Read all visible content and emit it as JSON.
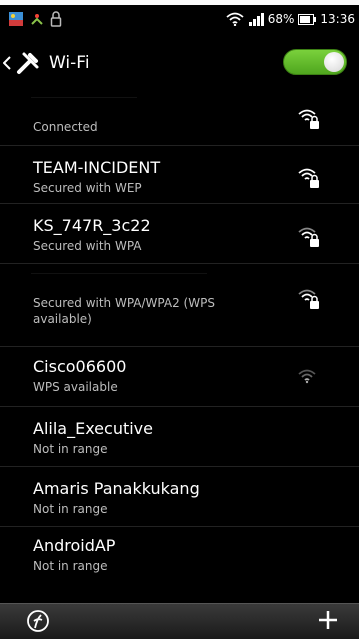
{
  "status_bar": {
    "battery_percent": "68%",
    "time": "13:36",
    "icons": [
      "notification-image-icon",
      "network-icon",
      "lock-icon",
      "wifi-status-icon",
      "signal-icon",
      "battery-icon"
    ]
  },
  "header": {
    "title": "Wi-Fi",
    "toggle_on": true,
    "accent": "#5cb82a"
  },
  "networks": [
    {
      "name": "",
      "status": "Connected",
      "secured": true,
      "signal": "strong"
    },
    {
      "name": "TEAM-INCIDENT",
      "status": "Secured with WEP",
      "secured": true,
      "signal": "strong"
    },
    {
      "name": "KS_747R_3c22",
      "status": "Secured with WPA",
      "secured": true,
      "signal": "medium"
    },
    {
      "name": "",
      "status": "Secured with WPA/WPA2 (WPS available)",
      "secured": true,
      "signal": "medium"
    },
    {
      "name": "Cisco06600",
      "status": "WPS available",
      "secured": false,
      "signal": "weak"
    },
    {
      "name": "Alila_Executive",
      "status": "Not in range"
    },
    {
      "name": "Amaris Panakkukang",
      "status": "Not in range"
    },
    {
      "name": "AndroidAP",
      "status": "Not in range"
    }
  ],
  "bottom_bar": {
    "left_icon": "wps-icon",
    "right_icon": "add-icon"
  }
}
